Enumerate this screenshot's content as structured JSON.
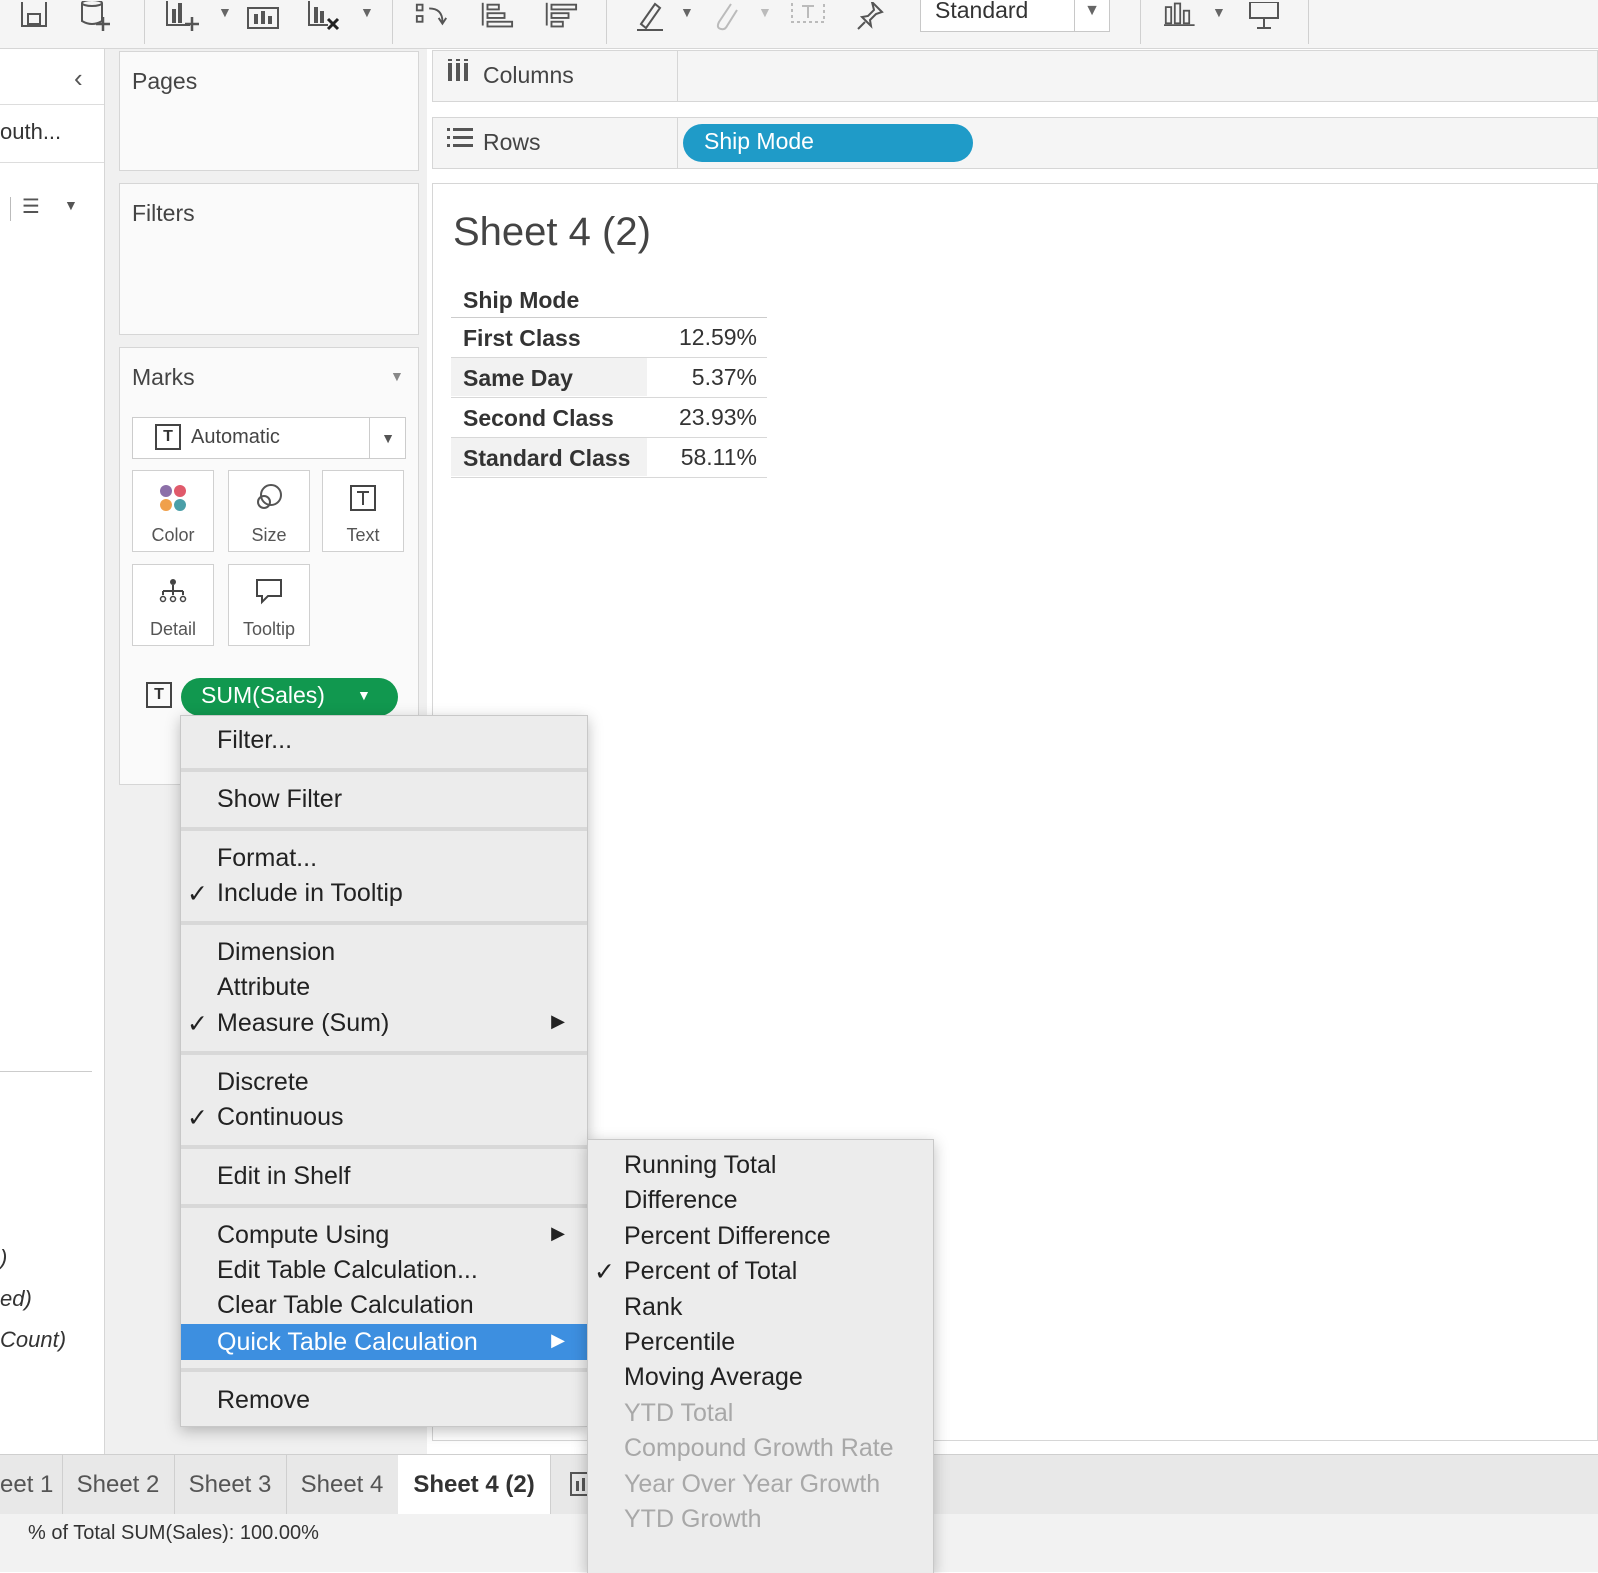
{
  "toolbar": {
    "view_size_dropdown": "Standard",
    "icons": [
      "save-icon",
      "new-datasource-icon",
      "new-worksheet-icon",
      "duplicate-sheet-icon",
      "clear-sheet-icon",
      "swap-icon",
      "sort-ascending-icon",
      "sort-descending-icon",
      "highlight-icon",
      "attach-icon",
      "label-icon",
      "pin-icon",
      "show-me-icon",
      "presentation-icon"
    ]
  },
  "left_pane": {
    "datasource_text": "outh...",
    "field_fragments": [
      ")",
      "ed)",
      "Count)"
    ]
  },
  "pages": {
    "title": "Pages"
  },
  "filters": {
    "title": "Filters"
  },
  "marks": {
    "title": "Marks",
    "type_dropdown": "Automatic",
    "buttons": {
      "color": "Color",
      "size": "Size",
      "text": "Text",
      "detail": "Detail",
      "tooltip": "Tooltip"
    },
    "pill": "SUM(Sales)"
  },
  "shelves": {
    "columns_label": "Columns",
    "rows_label": "Rows",
    "rows_pill": "Ship Mode"
  },
  "colors": {
    "dimension_pill": "#1f9bc8",
    "measure_pill": "#11984f",
    "menu_highlight": "#3d8fe0"
  },
  "sheet": {
    "title": "Sheet 4 (2)",
    "header": "Ship Mode",
    "rows": [
      {
        "name": "First Class",
        "value": "12.59%"
      },
      {
        "name": "Same Day",
        "value": "5.37%"
      },
      {
        "name": "Second Class",
        "value": "23.93%"
      },
      {
        "name": "Standard Class",
        "value": "58.11%"
      }
    ]
  },
  "context_menu": {
    "filter": "Filter...",
    "show_filter": "Show Filter",
    "format": "Format...",
    "include_tooltip": "Include in Tooltip",
    "dimension": "Dimension",
    "attribute": "Attribute",
    "measure": "Measure (Sum)",
    "discrete": "Discrete",
    "continuous": "Continuous",
    "edit_in_shelf": "Edit in Shelf",
    "compute_using": "Compute Using",
    "edit_table_calc": "Edit Table Calculation...",
    "clear_table_calc": "Clear Table Calculation",
    "quick_table_calc": "Quick Table Calculation",
    "remove": "Remove",
    "check": "✓",
    "submenu_arrow": "▶"
  },
  "submenu": {
    "items": [
      {
        "label": "Running Total",
        "enabled": true,
        "checked": false
      },
      {
        "label": "Difference",
        "enabled": true,
        "checked": false
      },
      {
        "label": "Percent Difference",
        "enabled": true,
        "checked": false
      },
      {
        "label": "Percent of Total",
        "enabled": true,
        "checked": true
      },
      {
        "label": "Rank",
        "enabled": true,
        "checked": false
      },
      {
        "label": "Percentile",
        "enabled": true,
        "checked": false
      },
      {
        "label": "Moving Average",
        "enabled": true,
        "checked": false
      },
      {
        "label": "YTD Total",
        "enabled": false,
        "checked": false
      },
      {
        "label": "Compound Growth Rate",
        "enabled": false,
        "checked": false
      },
      {
        "label": "Year Over Year Growth",
        "enabled": false,
        "checked": false
      },
      {
        "label": "YTD Growth",
        "enabled": false,
        "checked": false
      }
    ]
  },
  "tabs": [
    "eet 1",
    "Sheet 2",
    "Sheet 3",
    "Sheet 4",
    "Sheet 4 (2)"
  ],
  "status": "% of Total SUM(Sales): 100.00%"
}
